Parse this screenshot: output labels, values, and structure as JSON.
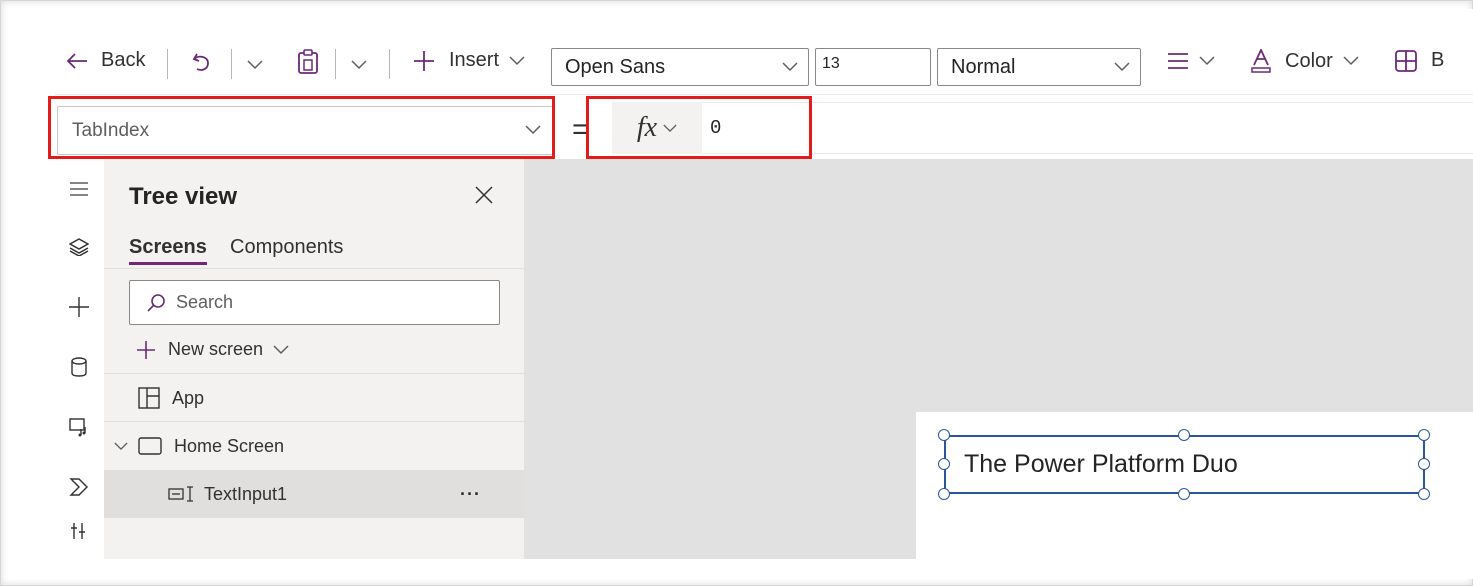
{
  "toolbar": {
    "back_label": "Back",
    "insert_label": "Insert",
    "font_family": "Open Sans",
    "font_size": "13",
    "font_weight": "Normal",
    "color_label": "Color",
    "cut_off_label": "B"
  },
  "formula_bar": {
    "property": "TabIndex",
    "equals": "=",
    "fx_label": "fx",
    "formula": "0"
  },
  "tree_view": {
    "title": "Tree view",
    "tabs": [
      {
        "label": "Screens",
        "active": true
      },
      {
        "label": "Components",
        "active": false
      }
    ],
    "search_placeholder": "Search",
    "new_screen_label": "New screen",
    "items": [
      {
        "label": "App",
        "icon": "app-grid-icon"
      },
      {
        "label": "Home Screen",
        "icon": "screen-icon"
      },
      {
        "label": "TextInput1",
        "icon": "text-input-icon"
      }
    ],
    "more_label": "···"
  },
  "canvas": {
    "text_input_value": "The Power Platform Duo"
  },
  "colors": {
    "accent": "#742774",
    "highlight": "#e31b1b",
    "selection": "#2b579a"
  }
}
